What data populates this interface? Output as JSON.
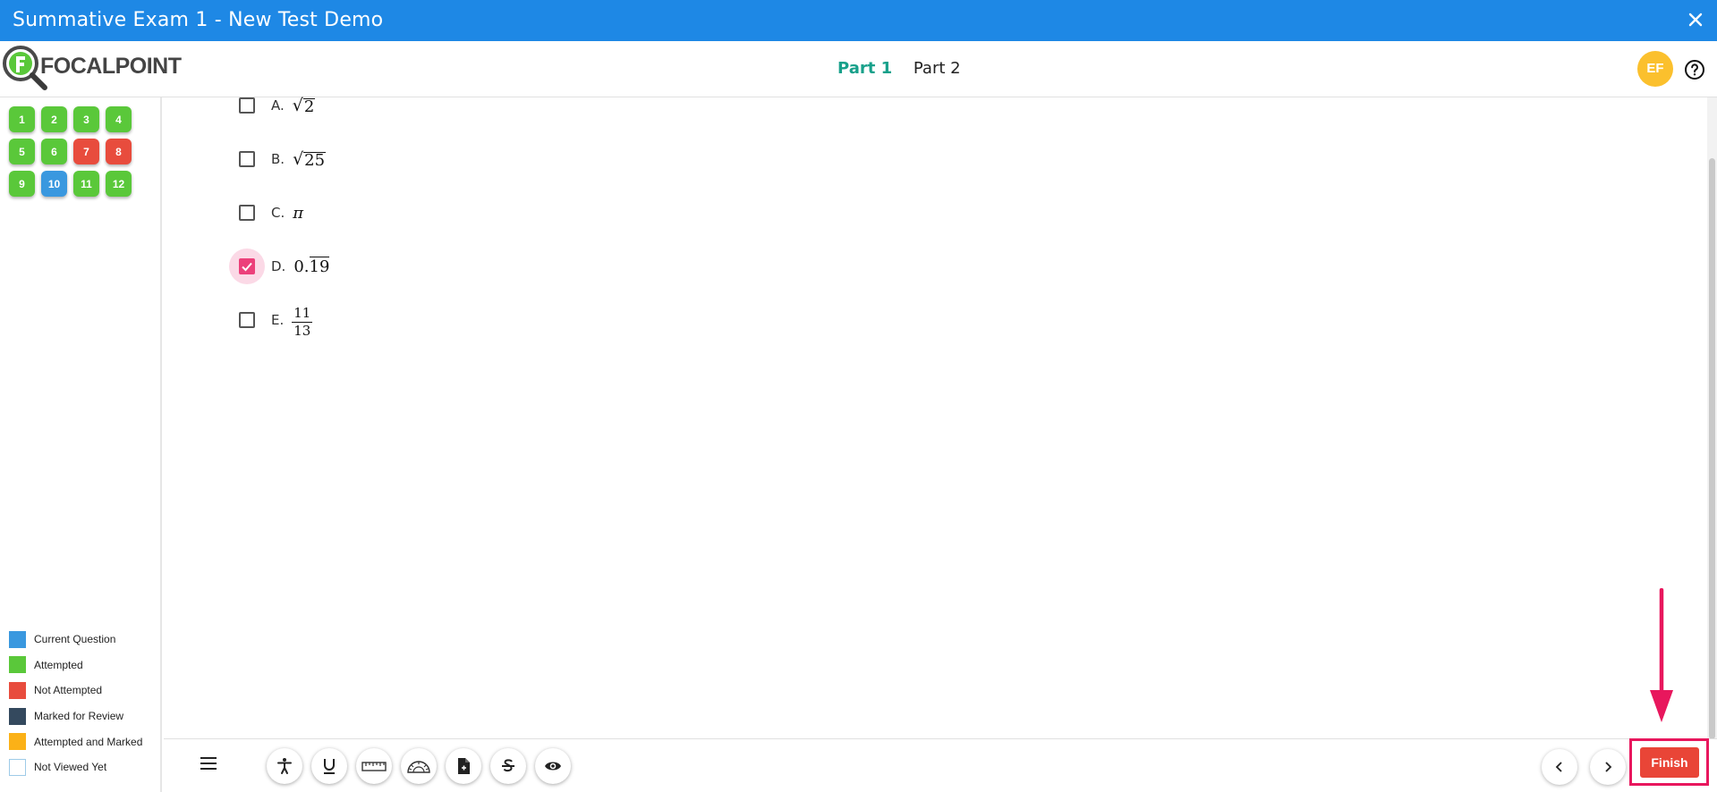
{
  "window": {
    "title": "Summative Exam 1 - New Test Demo"
  },
  "header": {
    "logo_text": "FOCALPOINT",
    "parts": [
      {
        "label": "Part 1",
        "active": true
      },
      {
        "label": "Part 2",
        "active": false
      }
    ],
    "avatar_initials": "EF"
  },
  "sidebar": {
    "questions": [
      {
        "number": "1",
        "status": "attempted"
      },
      {
        "number": "2",
        "status": "attempted"
      },
      {
        "number": "3",
        "status": "attempted"
      },
      {
        "number": "4",
        "status": "attempted"
      },
      {
        "number": "5",
        "status": "attempted"
      },
      {
        "number": "6",
        "status": "attempted"
      },
      {
        "number": "7",
        "status": "not-attempted"
      },
      {
        "number": "8",
        "status": "not-attempted"
      },
      {
        "number": "9",
        "status": "attempted"
      },
      {
        "number": "10",
        "status": "current"
      },
      {
        "number": "11",
        "status": "attempted"
      },
      {
        "number": "12",
        "status": "attempted"
      }
    ],
    "legend": [
      {
        "label": "Current Question",
        "color": "#3a98df"
      },
      {
        "label": "Attempted",
        "color": "#5ac83a"
      },
      {
        "label": "Not Attempted",
        "color": "#e84c3d"
      },
      {
        "label": "Marked for Review",
        "color": "#34495e"
      },
      {
        "label": "Attempted and Marked",
        "color": "#fbb117"
      },
      {
        "label": "Not Viewed Yet",
        "color": "#ffffff"
      }
    ]
  },
  "question": {
    "options": [
      {
        "letter": "A.",
        "checked": false,
        "radicand": "2"
      },
      {
        "letter": "B.",
        "checked": false,
        "radicand": "25"
      },
      {
        "letter": "C.",
        "checked": false,
        "value": "π"
      },
      {
        "letter": "D.",
        "checked": true,
        "prefix": "0.",
        "repeating": "19"
      },
      {
        "letter": "E.",
        "checked": false,
        "numerator": "11",
        "denominator": "13"
      }
    ]
  },
  "footer": {
    "tools": [
      "accessibility-icon",
      "underline-icon",
      "ruler-icon",
      "protractor-icon",
      "formula-sheet-icon",
      "strikethrough-icon",
      "eye-icon"
    ],
    "finish_label": "Finish"
  },
  "colors": {
    "titlebar": "#1e88e5",
    "active_part": "#17a08a",
    "checkbox_checked": "#ec407a",
    "finish": "#e94537",
    "highlight": "#e8175d",
    "avatar": "#fbc02d"
  }
}
